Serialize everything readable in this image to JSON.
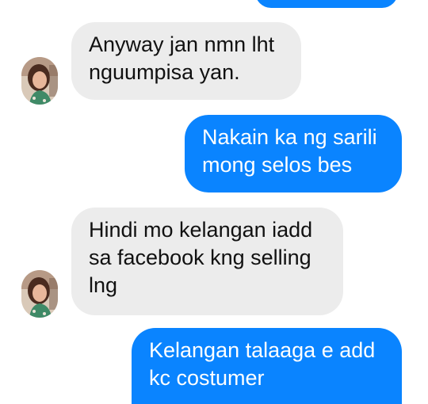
{
  "colors": {
    "outgoing_bubble": "#0a84ff",
    "incoming_bubble": "#ececec",
    "outgoing_text": "#ffffff",
    "incoming_text": "#111111"
  },
  "messages": [
    {
      "sender": "me",
      "text": ""
    },
    {
      "sender": "contact",
      "text": "Anyway jan nmn lht\nnguumpisa yan.",
      "avatar": "contact-avatar-icon"
    },
    {
      "sender": "me",
      "text": "Nakain ka ng sarili\nmong selos bes"
    },
    {
      "sender": "contact",
      "text": "Hindi mo kelangan iadd\nsa facebook kng selling\nlng",
      "avatar": "contact-avatar-icon"
    },
    {
      "sender": "me",
      "text": "Kelangan talaaga e add\nkc costumer"
    }
  ]
}
